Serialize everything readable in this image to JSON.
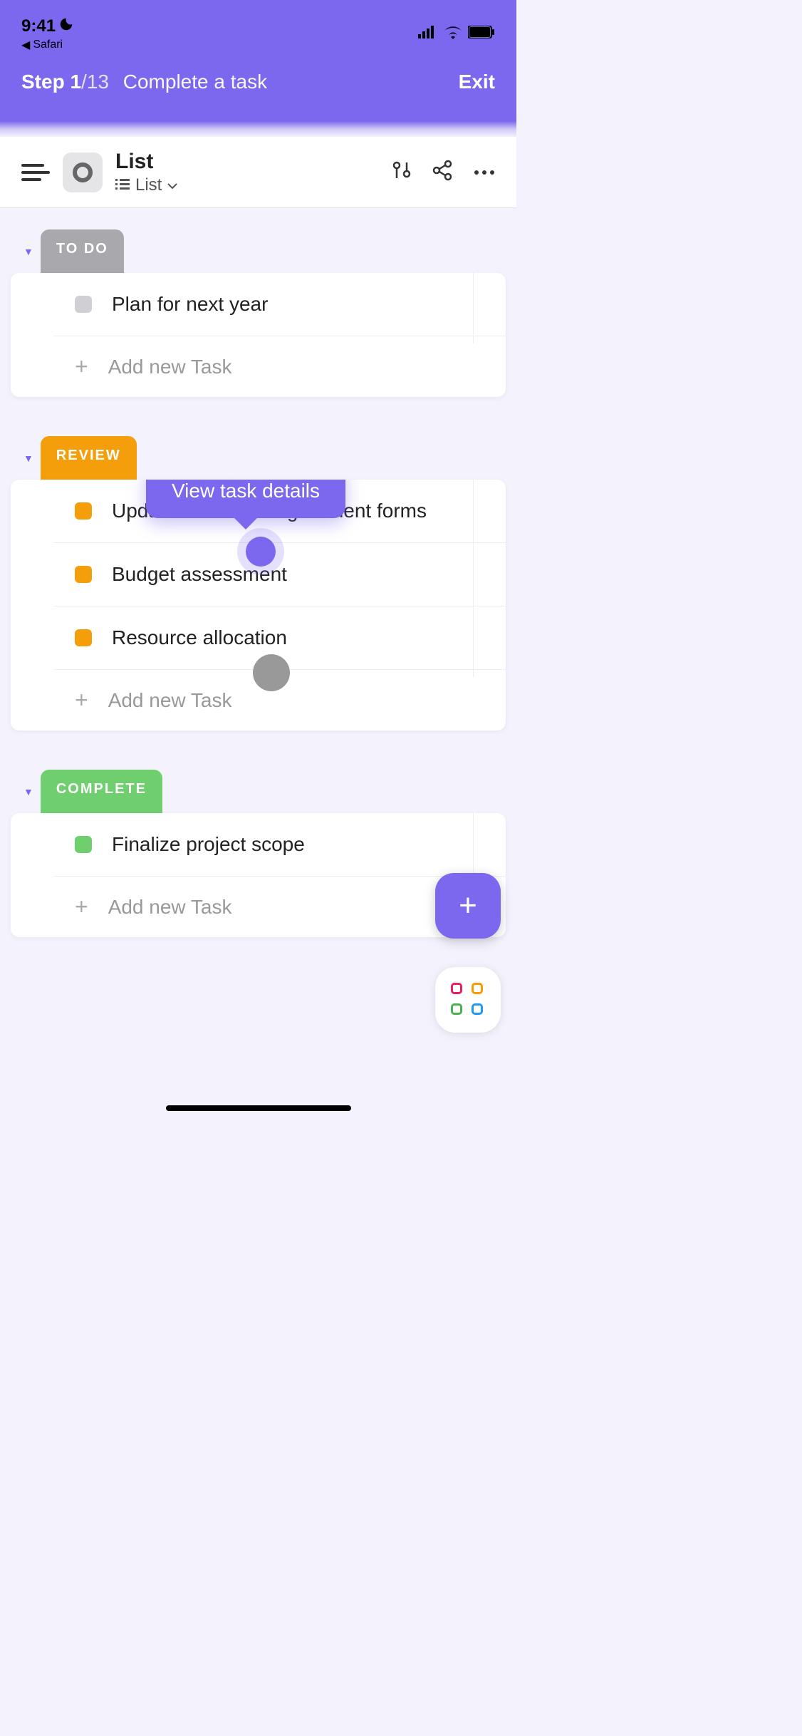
{
  "statusBar": {
    "time": "9:41",
    "backApp": "Safari"
  },
  "onboarding": {
    "stepPrefix": "Step ",
    "current": "1",
    "sep": "/",
    "total": "13",
    "title": "Complete a task",
    "exit": "Exit"
  },
  "header": {
    "title": "List",
    "viewName": "List"
  },
  "tooltip": {
    "text": "View task details"
  },
  "sections": {
    "todo": {
      "label": "TO DO",
      "addText": "Add new Task",
      "tasks": [
        {
          "title": "Plan for next year"
        }
      ]
    },
    "review": {
      "label": "REVIEW",
      "addText": "Add new Task",
      "tasks": [
        {
          "title": "Update contractor agreement forms"
        },
        {
          "title": "Budget assessment"
        },
        {
          "title": "Resource allocation"
        }
      ]
    },
    "complete": {
      "label": "COMPLETE",
      "addText": "Add new Task",
      "tasks": [
        {
          "title": "Finalize project scope"
        }
      ]
    }
  }
}
